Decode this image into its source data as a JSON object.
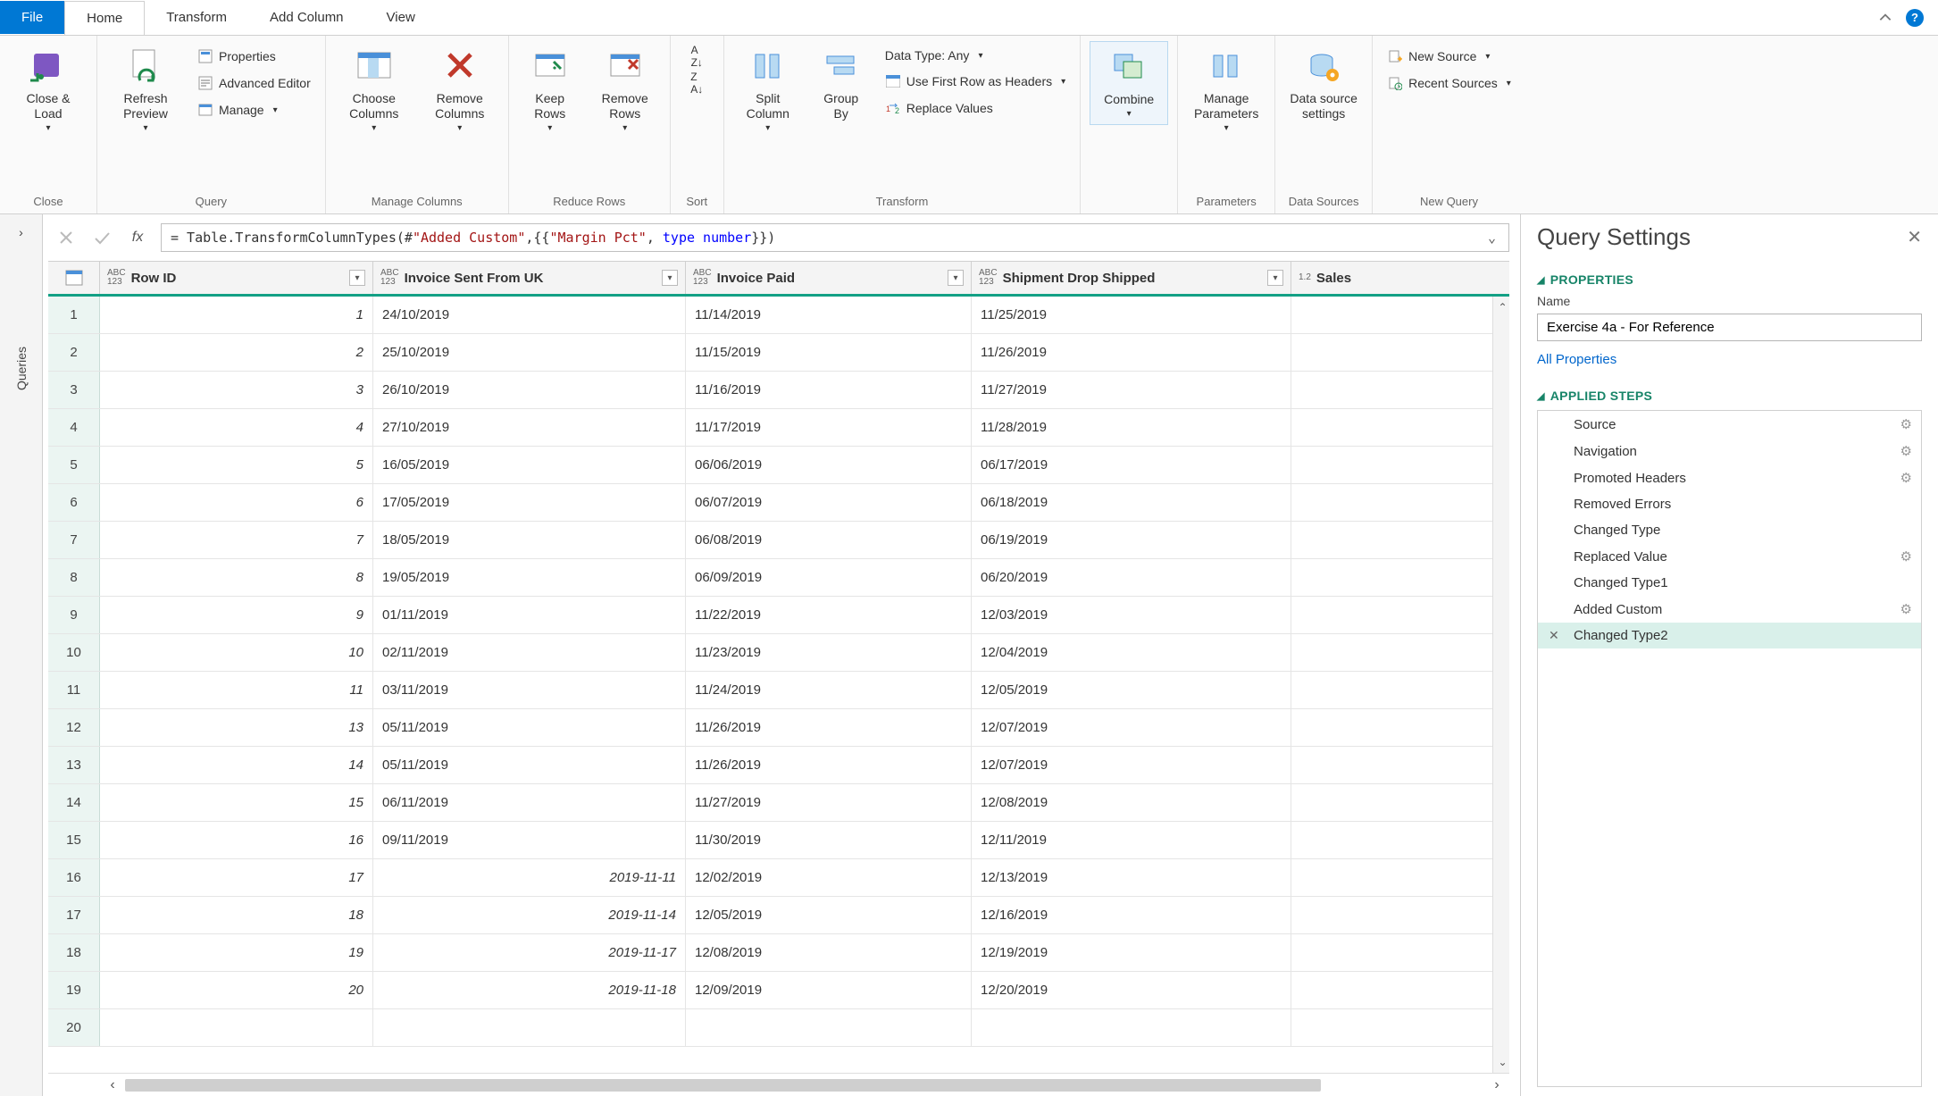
{
  "tabs": {
    "file": "File",
    "items": [
      "Home",
      "Transform",
      "Add Column",
      "View"
    ],
    "active": "Home"
  },
  "ribbon": {
    "close": {
      "close_load": "Close &\nLoad",
      "group": "Close"
    },
    "query": {
      "refresh": "Refresh\nPreview",
      "properties": "Properties",
      "advanced": "Advanced Editor",
      "manage": "Manage",
      "group": "Query"
    },
    "manage_cols": {
      "choose": "Choose\nColumns",
      "remove": "Remove\nColumns",
      "group": "Manage Columns"
    },
    "reduce_rows": {
      "keep": "Keep\nRows",
      "remove": "Remove\nRows",
      "group": "Reduce Rows"
    },
    "sort": {
      "group": "Sort"
    },
    "transform": {
      "split": "Split\nColumn",
      "groupby": "Group\nBy",
      "datatype": "Data Type: Any",
      "first_row": "Use First Row as Headers",
      "replace": "Replace Values",
      "group": "Transform"
    },
    "combine": {
      "label": "Combine"
    },
    "parameters": {
      "label": "Manage\nParameters",
      "group": "Parameters"
    },
    "datasources": {
      "label": "Data source\nsettings",
      "group": "Data Sources"
    },
    "newquery": {
      "new_source": "New Source",
      "recent": "Recent Sources",
      "group": "New Query"
    }
  },
  "formula": {
    "prefix": "= Table.TransformColumnTypes(#",
    "str1": "\"Added Custom\"",
    "mid1": ",{{",
    "str2": "\"Margin Pct\"",
    "mid2": ", ",
    "kw": "type number",
    "suffix": "}})"
  },
  "sidebar": {
    "label": "Queries"
  },
  "columns": [
    {
      "type": "ABC\n123",
      "name": "Row ID"
    },
    {
      "type": "ABC\n123",
      "name": "Invoice Sent From UK"
    },
    {
      "type": "ABC\n123",
      "name": "Invoice Paid"
    },
    {
      "type": "ABC\n123",
      "name": "Shipment Drop Shipped"
    },
    {
      "type": "1.2",
      "name": "Sales"
    }
  ],
  "rows": [
    {
      "n": 1,
      "id": "1",
      "c1": "24/10/2019",
      "iso": false,
      "c2": "11/14/2019",
      "c3": "11/25/2019"
    },
    {
      "n": 2,
      "id": "2",
      "c1": "25/10/2019",
      "iso": false,
      "c2": "11/15/2019",
      "c3": "11/26/2019"
    },
    {
      "n": 3,
      "id": "3",
      "c1": "26/10/2019",
      "iso": false,
      "c2": "11/16/2019",
      "c3": "11/27/2019"
    },
    {
      "n": 4,
      "id": "4",
      "c1": "27/10/2019",
      "iso": false,
      "c2": "11/17/2019",
      "c3": "11/28/2019"
    },
    {
      "n": 5,
      "id": "5",
      "c1": "16/05/2019",
      "iso": false,
      "c2": "06/06/2019",
      "c3": "06/17/2019"
    },
    {
      "n": 6,
      "id": "6",
      "c1": "17/05/2019",
      "iso": false,
      "c2": "06/07/2019",
      "c3": "06/18/2019"
    },
    {
      "n": 7,
      "id": "7",
      "c1": "18/05/2019",
      "iso": false,
      "c2": "06/08/2019",
      "c3": "06/19/2019"
    },
    {
      "n": 8,
      "id": "8",
      "c1": "19/05/2019",
      "iso": false,
      "c2": "06/09/2019",
      "c3": "06/20/2019"
    },
    {
      "n": 9,
      "id": "9",
      "c1": "01/11/2019",
      "iso": false,
      "c2": "11/22/2019",
      "c3": "12/03/2019"
    },
    {
      "n": 10,
      "id": "10",
      "c1": "02/11/2019",
      "iso": false,
      "c2": "11/23/2019",
      "c3": "12/04/2019"
    },
    {
      "n": 11,
      "id": "11",
      "c1": "03/11/2019",
      "iso": false,
      "c2": "11/24/2019",
      "c3": "12/05/2019"
    },
    {
      "n": 12,
      "id": "13",
      "c1": "05/11/2019",
      "iso": false,
      "c2": "11/26/2019",
      "c3": "12/07/2019"
    },
    {
      "n": 13,
      "id": "14",
      "c1": "05/11/2019",
      "iso": false,
      "c2": "11/26/2019",
      "c3": "12/07/2019"
    },
    {
      "n": 14,
      "id": "15",
      "c1": "06/11/2019",
      "iso": false,
      "c2": "11/27/2019",
      "c3": "12/08/2019"
    },
    {
      "n": 15,
      "id": "16",
      "c1": "09/11/2019",
      "iso": false,
      "c2": "11/30/2019",
      "c3": "12/11/2019"
    },
    {
      "n": 16,
      "id": "17",
      "c1": "2019-11-11",
      "iso": true,
      "c2": "12/02/2019",
      "c3": "12/13/2019"
    },
    {
      "n": 17,
      "id": "18",
      "c1": "2019-11-14",
      "iso": true,
      "c2": "12/05/2019",
      "c3": "12/16/2019"
    },
    {
      "n": 18,
      "id": "19",
      "c1": "2019-11-17",
      "iso": true,
      "c2": "12/08/2019",
      "c3": "12/19/2019"
    },
    {
      "n": 19,
      "id": "20",
      "c1": "2019-11-18",
      "iso": true,
      "c2": "12/09/2019",
      "c3": "12/20/2019"
    },
    {
      "n": 20,
      "id": "",
      "c1": "",
      "iso": false,
      "c2": "",
      "c3": ""
    }
  ],
  "settings": {
    "title": "Query Settings",
    "properties": "PROPERTIES",
    "name_label": "Name",
    "name_value": "Exercise 4a - For Reference",
    "all_props": "All Properties",
    "applied": "APPLIED STEPS",
    "steps": [
      {
        "label": "Source",
        "gear": true
      },
      {
        "label": "Navigation",
        "gear": true
      },
      {
        "label": "Promoted Headers",
        "gear": true
      },
      {
        "label": "Removed Errors",
        "gear": false
      },
      {
        "label": "Changed Type",
        "gear": false
      },
      {
        "label": "Replaced Value",
        "gear": true
      },
      {
        "label": "Changed Type1",
        "gear": false
      },
      {
        "label": "Added Custom",
        "gear": true
      },
      {
        "label": "Changed Type2",
        "gear": false,
        "active": true
      }
    ]
  }
}
